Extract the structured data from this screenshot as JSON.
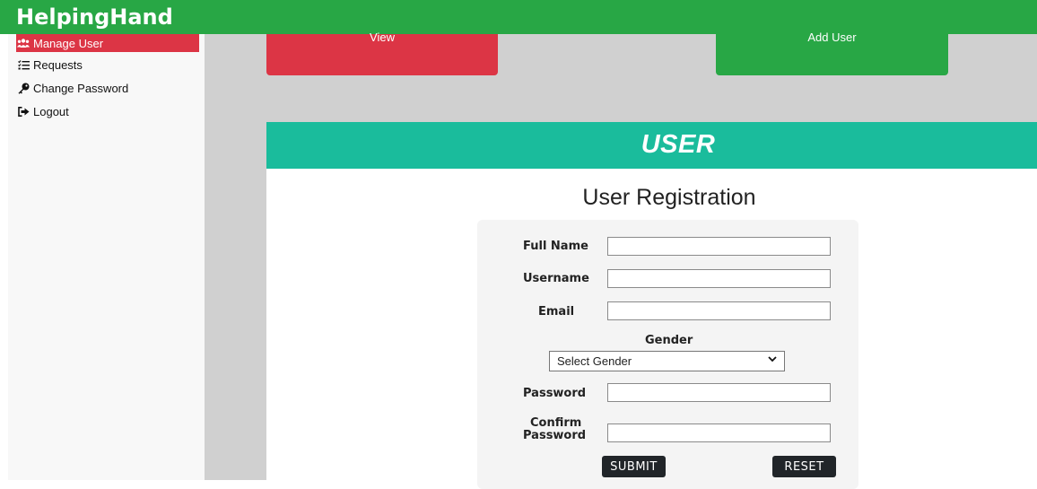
{
  "app": {
    "brand": "HelpingHand"
  },
  "sidebar": {
    "items": [
      {
        "label": "Manage User",
        "icon": "users-icon"
      },
      {
        "label": "Requests",
        "icon": "list-icon"
      },
      {
        "label": "Change Password",
        "icon": "key-icon"
      },
      {
        "label": "Logout",
        "icon": "sign-out-icon"
      }
    ]
  },
  "actions": {
    "view_label": "View",
    "add_label": "Add User"
  },
  "panel": {
    "title": "USER",
    "subtitle": "User Registration"
  },
  "form": {
    "full_name_label": "Full Name",
    "username_label": "Username",
    "email_label": "Email",
    "gender_label": "Gender",
    "gender_selected": "Select Gender",
    "password_label": "Password",
    "confirm_label_1": "Confirm",
    "confirm_label_2": "Password",
    "submit_label": "SUBMIT",
    "reset_label": "RESET"
  },
  "colors": {
    "topbar": "#28a745",
    "active_nav": "#dc3545",
    "view_button": "#dc3545",
    "add_button": "#28a745",
    "panel_header": "#1abc9c"
  }
}
